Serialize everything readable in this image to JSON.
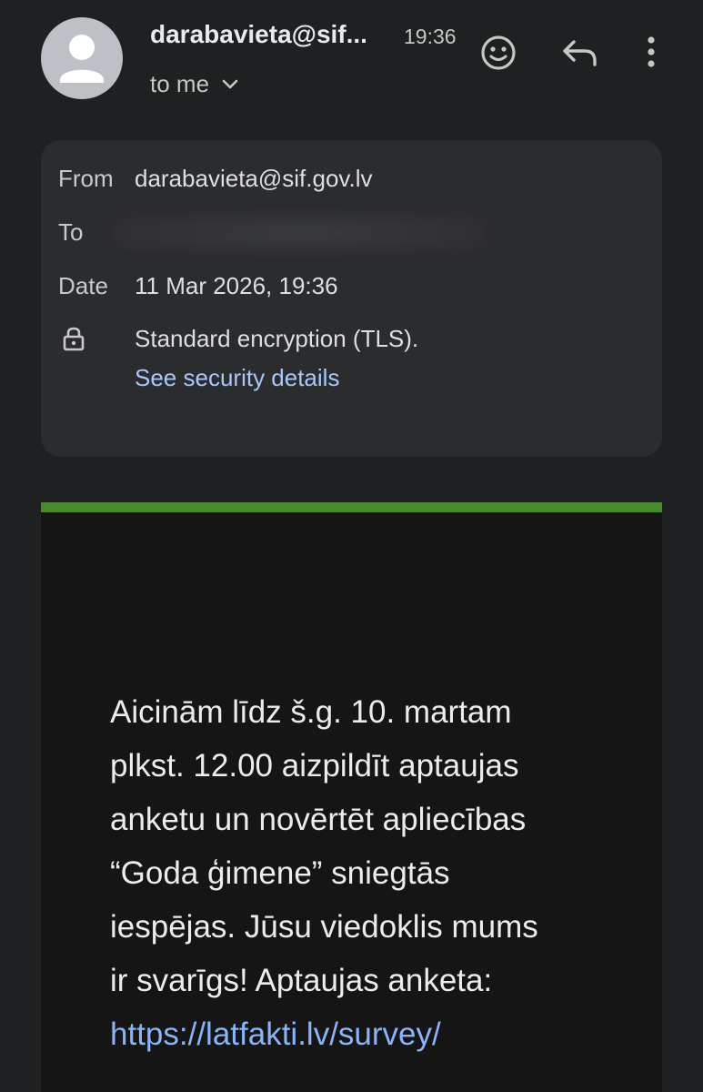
{
  "header": {
    "sender": "darabavieta@sif...",
    "time": "19:36",
    "recipient_label": "to me",
    "icons": [
      "avatar-icon",
      "emoji-icon",
      "reply-icon",
      "more-vert-icon",
      "chevron-down-icon"
    ]
  },
  "details": {
    "from_label": "From",
    "from_value": "darabavieta@sif.gov.lv",
    "to_label": "To",
    "date_label": "Date",
    "date_value": "11 Mar 2026, 19:36",
    "encryption_text": "Standard encryption (TLS).",
    "security_link": "See security details"
  },
  "body": {
    "lines": [
      "Aicinām līdz š.g. 10. martam",
      "plkst. 12.00 aizpildīt aptaujas",
      "anketu un novērtēt apliecības",
      "“Goda ģimene” sniegtās",
      "iespējas. Jūsu viedoklis mums",
      "ir svarīgs! Aptaujas anketa:"
    ],
    "link": "https://latfakti.lv/survey/"
  },
  "colors": {
    "background": "#1f2022",
    "card": "#2b2c2e",
    "link": "#a8c7fa",
    "accent_bar": "#4a8a2c",
    "body_background": "#151515"
  }
}
